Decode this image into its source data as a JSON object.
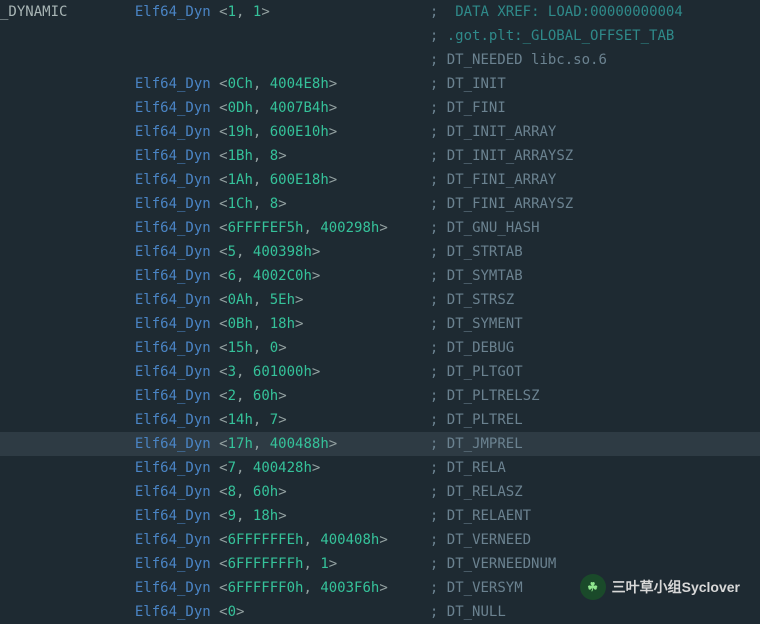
{
  "label": "_DYNAMIC",
  "type": "Elf64_Dyn",
  "xref1": "DATA XREF: LOAD:00000000004",
  "xref2": ".got.plt:_GLOBAL_OFFSET_TAB",
  "first": {
    "v1": "1",
    "v2": "1",
    "tag": "DT_NEEDED libc.so.6"
  },
  "rows": [
    {
      "v1": "0Ch",
      "v2": "4004E8h",
      "tag": "DT_INIT"
    },
    {
      "v1": "0Dh",
      "v2": "4007B4h",
      "tag": "DT_FINI"
    },
    {
      "v1": "19h",
      "v2": "600E10h",
      "tag": "DT_INIT_ARRAY"
    },
    {
      "v1": "1Bh",
      "v2": "8",
      "tag": "DT_INIT_ARRAYSZ"
    },
    {
      "v1": "1Ah",
      "v2": "600E18h",
      "tag": "DT_FINI_ARRAY"
    },
    {
      "v1": "1Ch",
      "v2": "8",
      "tag": "DT_FINI_ARRAYSZ"
    },
    {
      "v1": "6FFFFEF5h",
      "v2": "400298h",
      "tag": "DT_GNU_HASH"
    },
    {
      "v1": "5",
      "v2": "400398h",
      "tag": "DT_STRTAB"
    },
    {
      "v1": "6",
      "v2": "4002C0h",
      "tag": "DT_SYMTAB"
    },
    {
      "v1": "0Ah",
      "v2": "5Eh",
      "tag": "DT_STRSZ"
    },
    {
      "v1": "0Bh",
      "v2": "18h",
      "tag": "DT_SYMENT"
    },
    {
      "v1": "15h",
      "v2": "0",
      "tag": "DT_DEBUG"
    },
    {
      "v1": "3",
      "v2": "601000h",
      "tag": "DT_PLTGOT"
    },
    {
      "v1": "2",
      "v2": "60h",
      "tag": "DT_PLTRELSZ"
    },
    {
      "v1": "14h",
      "v2": "7",
      "tag": "DT_PLTREL"
    },
    {
      "v1": "17h",
      "v2": "400488h",
      "tag": "DT_JMPREL",
      "highlight": true
    },
    {
      "v1": "7",
      "v2": "400428h",
      "tag": "DT_RELA"
    },
    {
      "v1": "8",
      "v2": "60h",
      "tag": "DT_RELASZ"
    },
    {
      "v1": "9",
      "v2": "18h",
      "tag": "DT_RELAENT"
    },
    {
      "v1": "6FFFFFFEh",
      "v2": "400408h",
      "tag": "DT_VERNEED"
    },
    {
      "v1": "6FFFFFFFh",
      "v2": "1",
      "tag": "DT_VERNEEDNUM"
    },
    {
      "v1": "6FFFFFF0h",
      "v2": "4003F6h",
      "tag": "DT_VERSYM"
    },
    {
      "v1": "0",
      "v2": null,
      "tag": "DT_NULL"
    }
  ],
  "indent": "                ",
  "valuesColumn": 25,
  "watermark": "三叶草小组Syclover"
}
